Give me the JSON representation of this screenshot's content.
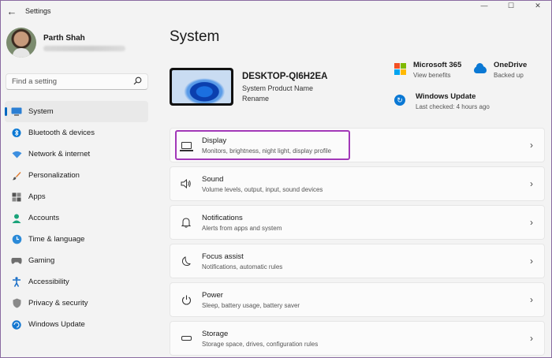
{
  "window": {
    "title": "Settings",
    "back_glyph": "←",
    "controls": {
      "minimize": "—",
      "maximize": "☐",
      "close": "✕"
    }
  },
  "profile": {
    "name": "Parth Shah"
  },
  "search": {
    "placeholder": "Find a setting",
    "icon": "search-icon"
  },
  "sidebar": {
    "items": [
      {
        "label": "System",
        "icon": "monitor-icon",
        "active": true
      },
      {
        "label": "Bluetooth & devices",
        "icon": "bluetooth-icon"
      },
      {
        "label": "Network & internet",
        "icon": "wifi-icon"
      },
      {
        "label": "Personalization",
        "icon": "brush-icon"
      },
      {
        "label": "Apps",
        "icon": "apps-icon"
      },
      {
        "label": "Accounts",
        "icon": "person-icon"
      },
      {
        "label": "Time & language",
        "icon": "globe-clock-icon"
      },
      {
        "label": "Gaming",
        "icon": "gamepad-icon"
      },
      {
        "label": "Accessibility",
        "icon": "accessibility-icon"
      },
      {
        "label": "Privacy & security",
        "icon": "shield-icon"
      },
      {
        "label": "Windows Update",
        "icon": "update-icon"
      }
    ]
  },
  "main": {
    "title": "System",
    "device": {
      "name": "DESKTOP-QI6H2EA",
      "model": "System Product Name",
      "rename": "Rename"
    },
    "quick": {
      "m365": {
        "title": "Microsoft 365",
        "subtitle": "View benefits"
      },
      "onedrive": {
        "title": "OneDrive",
        "subtitle": "Backed up"
      },
      "update": {
        "title": "Windows Update",
        "subtitle": "Last checked: 4 hours ago"
      }
    },
    "cards": [
      {
        "title": "Display",
        "subtitle": "Monitors, brightness, night light, display profile",
        "icon": "display-icon"
      },
      {
        "title": "Sound",
        "subtitle": "Volume levels, output, input, sound devices",
        "icon": "speaker-icon"
      },
      {
        "title": "Notifications",
        "subtitle": "Alerts from apps and system",
        "icon": "bell-icon"
      },
      {
        "title": "Focus assist",
        "subtitle": "Notifications, automatic rules",
        "icon": "moon-icon"
      },
      {
        "title": "Power",
        "subtitle": "Sleep, battery usage, battery saver",
        "icon": "power-icon"
      },
      {
        "title": "Storage",
        "subtitle": "Storage space, drives, configuration rules",
        "icon": "storage-icon"
      }
    ],
    "chevron": "›"
  },
  "colors": {
    "accent": "#0067c0",
    "highlight": "#a238b8",
    "ms_red": "#f25022",
    "ms_green": "#7fba00",
    "ms_blue": "#00a4ef",
    "ms_yellow": "#ffb900"
  }
}
